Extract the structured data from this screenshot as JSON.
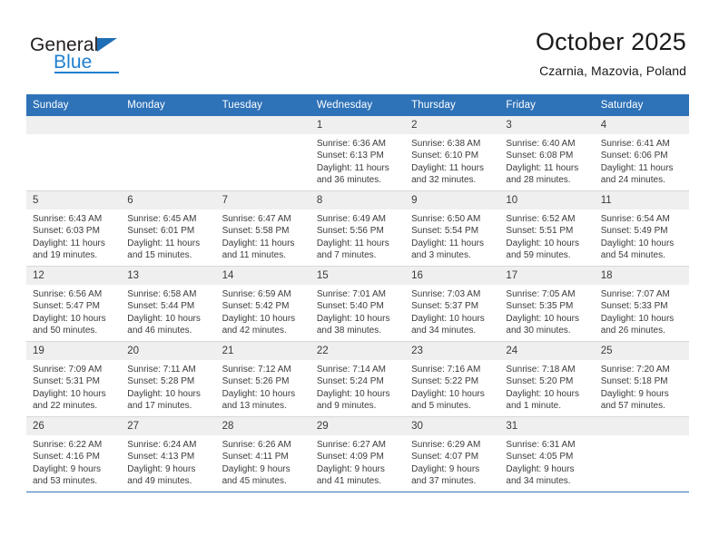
{
  "brand": {
    "name_top": "General",
    "name_bottom": "Blue",
    "accent_color": "#1f7fd0",
    "triangle_color": "#1f6eb5"
  },
  "header": {
    "title": "October 2025",
    "subtitle": "Czarnia, Mazovia, Poland"
  },
  "theme": {
    "header_blue": "#2e72b8",
    "daynum_band": "#efefef",
    "grid_line": "#d8d8d8",
    "text": "#3b3b3b"
  },
  "weekday_headers": [
    "Sunday",
    "Monday",
    "Tuesday",
    "Wednesday",
    "Thursday",
    "Friday",
    "Saturday"
  ],
  "weeks": [
    [
      {
        "day": "",
        "empty": true,
        "sunrise": "",
        "sunset": "",
        "daylight": ""
      },
      {
        "day": "",
        "empty": true,
        "sunrise": "",
        "sunset": "",
        "daylight": ""
      },
      {
        "day": "",
        "empty": true,
        "sunrise": "",
        "sunset": "",
        "daylight": ""
      },
      {
        "day": "1",
        "empty": false,
        "sunrise": "Sunrise: 6:36 AM",
        "sunset": "Sunset: 6:13 PM",
        "daylight": "Daylight: 11 hours and 36 minutes."
      },
      {
        "day": "2",
        "empty": false,
        "sunrise": "Sunrise: 6:38 AM",
        "sunset": "Sunset: 6:10 PM",
        "daylight": "Daylight: 11 hours and 32 minutes."
      },
      {
        "day": "3",
        "empty": false,
        "sunrise": "Sunrise: 6:40 AM",
        "sunset": "Sunset: 6:08 PM",
        "daylight": "Daylight: 11 hours and 28 minutes."
      },
      {
        "day": "4",
        "empty": false,
        "sunrise": "Sunrise: 6:41 AM",
        "sunset": "Sunset: 6:06 PM",
        "daylight": "Daylight: 11 hours and 24 minutes."
      }
    ],
    [
      {
        "day": "5",
        "empty": false,
        "sunrise": "Sunrise: 6:43 AM",
        "sunset": "Sunset: 6:03 PM",
        "daylight": "Daylight: 11 hours and 19 minutes."
      },
      {
        "day": "6",
        "empty": false,
        "sunrise": "Sunrise: 6:45 AM",
        "sunset": "Sunset: 6:01 PM",
        "daylight": "Daylight: 11 hours and 15 minutes."
      },
      {
        "day": "7",
        "empty": false,
        "sunrise": "Sunrise: 6:47 AM",
        "sunset": "Sunset: 5:58 PM",
        "daylight": "Daylight: 11 hours and 11 minutes."
      },
      {
        "day": "8",
        "empty": false,
        "sunrise": "Sunrise: 6:49 AM",
        "sunset": "Sunset: 5:56 PM",
        "daylight": "Daylight: 11 hours and 7 minutes."
      },
      {
        "day": "9",
        "empty": false,
        "sunrise": "Sunrise: 6:50 AM",
        "sunset": "Sunset: 5:54 PM",
        "daylight": "Daylight: 11 hours and 3 minutes."
      },
      {
        "day": "10",
        "empty": false,
        "sunrise": "Sunrise: 6:52 AM",
        "sunset": "Sunset: 5:51 PM",
        "daylight": "Daylight: 10 hours and 59 minutes."
      },
      {
        "day": "11",
        "empty": false,
        "sunrise": "Sunrise: 6:54 AM",
        "sunset": "Sunset: 5:49 PM",
        "daylight": "Daylight: 10 hours and 54 minutes."
      }
    ],
    [
      {
        "day": "12",
        "empty": false,
        "sunrise": "Sunrise: 6:56 AM",
        "sunset": "Sunset: 5:47 PM",
        "daylight": "Daylight: 10 hours and 50 minutes."
      },
      {
        "day": "13",
        "empty": false,
        "sunrise": "Sunrise: 6:58 AM",
        "sunset": "Sunset: 5:44 PM",
        "daylight": "Daylight: 10 hours and 46 minutes."
      },
      {
        "day": "14",
        "empty": false,
        "sunrise": "Sunrise: 6:59 AM",
        "sunset": "Sunset: 5:42 PM",
        "daylight": "Daylight: 10 hours and 42 minutes."
      },
      {
        "day": "15",
        "empty": false,
        "sunrise": "Sunrise: 7:01 AM",
        "sunset": "Sunset: 5:40 PM",
        "daylight": "Daylight: 10 hours and 38 minutes."
      },
      {
        "day": "16",
        "empty": false,
        "sunrise": "Sunrise: 7:03 AM",
        "sunset": "Sunset: 5:37 PM",
        "daylight": "Daylight: 10 hours and 34 minutes."
      },
      {
        "day": "17",
        "empty": false,
        "sunrise": "Sunrise: 7:05 AM",
        "sunset": "Sunset: 5:35 PM",
        "daylight": "Daylight: 10 hours and 30 minutes."
      },
      {
        "day": "18",
        "empty": false,
        "sunrise": "Sunrise: 7:07 AM",
        "sunset": "Sunset: 5:33 PM",
        "daylight": "Daylight: 10 hours and 26 minutes."
      }
    ],
    [
      {
        "day": "19",
        "empty": false,
        "sunrise": "Sunrise: 7:09 AM",
        "sunset": "Sunset: 5:31 PM",
        "daylight": "Daylight: 10 hours and 22 minutes."
      },
      {
        "day": "20",
        "empty": false,
        "sunrise": "Sunrise: 7:11 AM",
        "sunset": "Sunset: 5:28 PM",
        "daylight": "Daylight: 10 hours and 17 minutes."
      },
      {
        "day": "21",
        "empty": false,
        "sunrise": "Sunrise: 7:12 AM",
        "sunset": "Sunset: 5:26 PM",
        "daylight": "Daylight: 10 hours and 13 minutes."
      },
      {
        "day": "22",
        "empty": false,
        "sunrise": "Sunrise: 7:14 AM",
        "sunset": "Sunset: 5:24 PM",
        "daylight": "Daylight: 10 hours and 9 minutes."
      },
      {
        "day": "23",
        "empty": false,
        "sunrise": "Sunrise: 7:16 AM",
        "sunset": "Sunset: 5:22 PM",
        "daylight": "Daylight: 10 hours and 5 minutes."
      },
      {
        "day": "24",
        "empty": false,
        "sunrise": "Sunrise: 7:18 AM",
        "sunset": "Sunset: 5:20 PM",
        "daylight": "Daylight: 10 hours and 1 minute."
      },
      {
        "day": "25",
        "empty": false,
        "sunrise": "Sunrise: 7:20 AM",
        "sunset": "Sunset: 5:18 PM",
        "daylight": "Daylight: 9 hours and 57 minutes."
      }
    ],
    [
      {
        "day": "26",
        "empty": false,
        "sunrise": "Sunrise: 6:22 AM",
        "sunset": "Sunset: 4:16 PM",
        "daylight": "Daylight: 9 hours and 53 minutes."
      },
      {
        "day": "27",
        "empty": false,
        "sunrise": "Sunrise: 6:24 AM",
        "sunset": "Sunset: 4:13 PM",
        "daylight": "Daylight: 9 hours and 49 minutes."
      },
      {
        "day": "28",
        "empty": false,
        "sunrise": "Sunrise: 6:26 AM",
        "sunset": "Sunset: 4:11 PM",
        "daylight": "Daylight: 9 hours and 45 minutes."
      },
      {
        "day": "29",
        "empty": false,
        "sunrise": "Sunrise: 6:27 AM",
        "sunset": "Sunset: 4:09 PM",
        "daylight": "Daylight: 9 hours and 41 minutes."
      },
      {
        "day": "30",
        "empty": false,
        "sunrise": "Sunrise: 6:29 AM",
        "sunset": "Sunset: 4:07 PM",
        "daylight": "Daylight: 9 hours and 37 minutes."
      },
      {
        "day": "31",
        "empty": false,
        "sunrise": "Sunrise: 6:31 AM",
        "sunset": "Sunset: 4:05 PM",
        "daylight": "Daylight: 9 hours and 34 minutes."
      },
      {
        "day": "",
        "empty": true,
        "sunrise": "",
        "sunset": "",
        "daylight": ""
      }
    ]
  ]
}
